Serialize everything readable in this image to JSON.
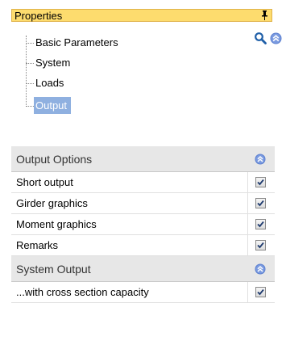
{
  "panel": {
    "title": "Properties",
    "tree": [
      {
        "label": "Basic Parameters",
        "selected": false
      },
      {
        "label": "System",
        "selected": false
      },
      {
        "label": "Loads",
        "selected": false
      },
      {
        "label": "Output",
        "selected": true
      }
    ]
  },
  "sections": [
    {
      "title": "Output Options",
      "rows": [
        {
          "label": "Short output",
          "checked": true
        },
        {
          "label": "Girder graphics",
          "checked": true
        },
        {
          "label": "Moment graphics",
          "checked": true
        },
        {
          "label": "Remarks",
          "checked": true
        }
      ]
    },
    {
      "title": "System Output",
      "rows": [
        {
          "label": "...with cross section capacity",
          "checked": true
        }
      ]
    }
  ],
  "colors": {
    "header_bg": "#fddc6e",
    "selection_bg": "#8fb0e0",
    "category_bg": "#e7e7e7",
    "collapse_icon": "#5b7fcf"
  },
  "icons": [
    "pin-icon",
    "search-icon",
    "collapse-icon",
    "check-icon"
  ]
}
